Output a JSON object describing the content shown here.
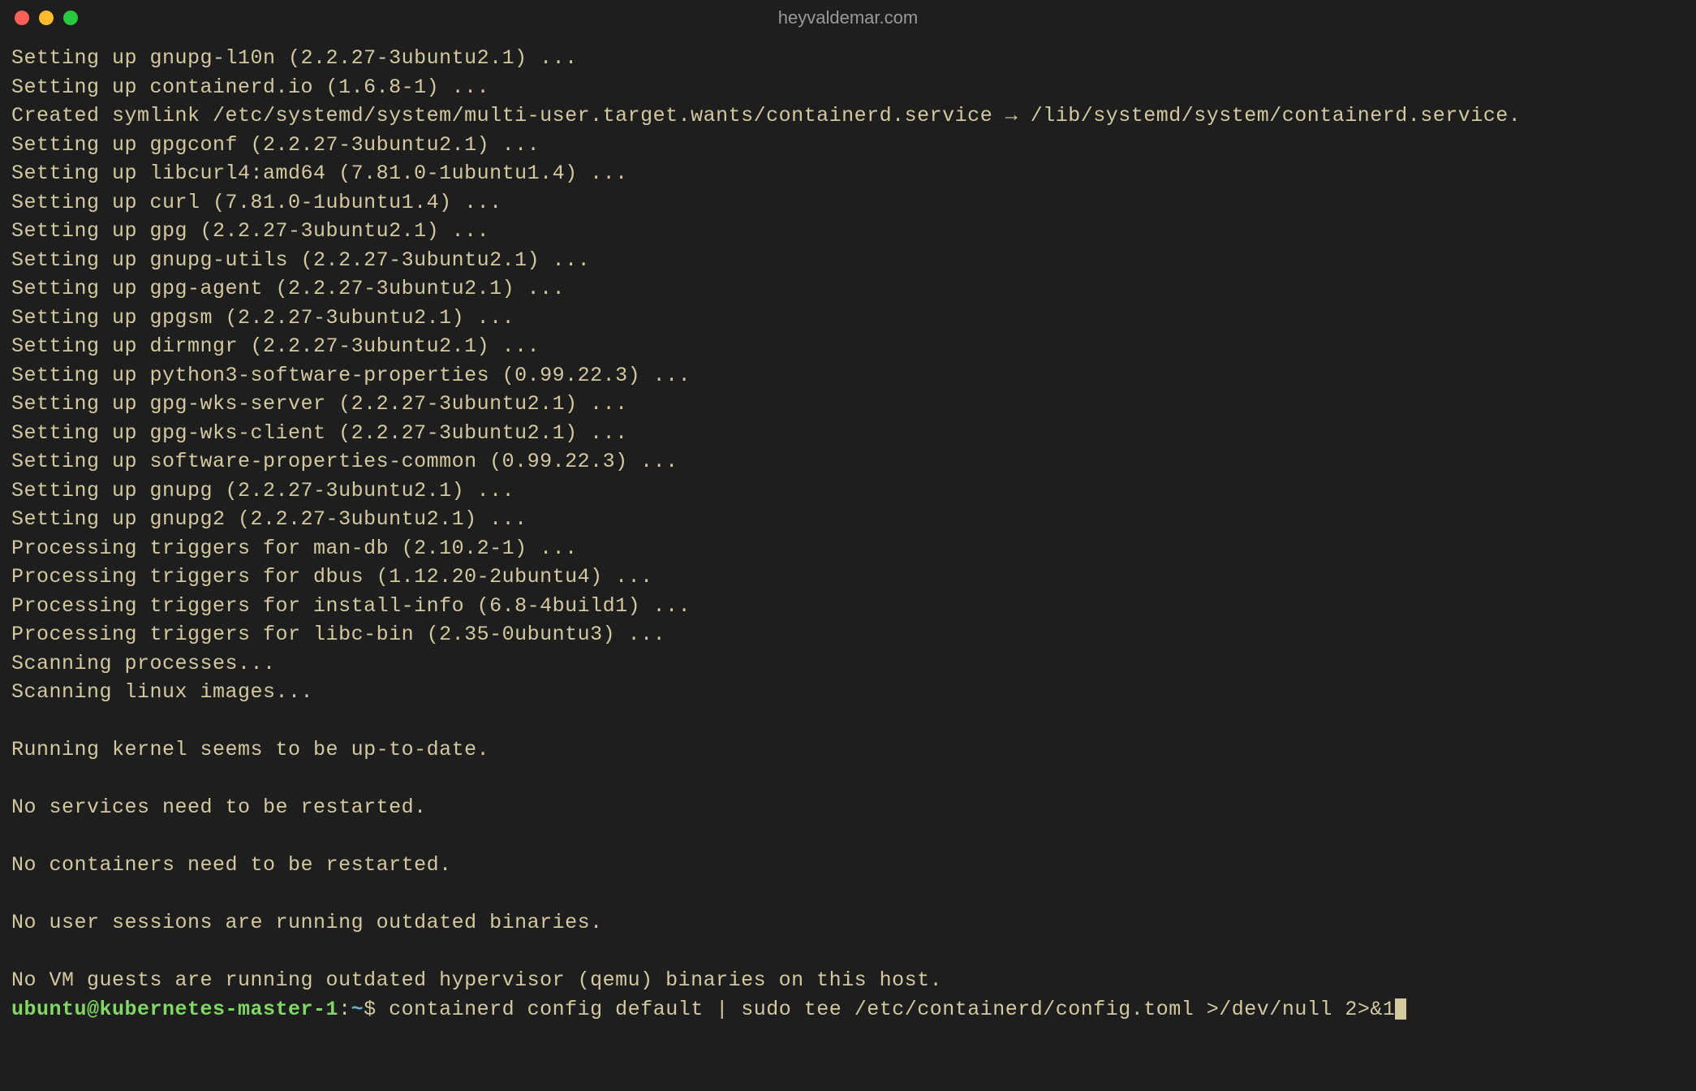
{
  "window": {
    "title": "heyvaldemar.com"
  },
  "output_lines": [
    "Setting up gnupg-l10n (2.2.27-3ubuntu2.1) ...",
    "Setting up containerd.io (1.6.8-1) ...",
    "Created symlink /etc/systemd/system/multi-user.target.wants/containerd.service → /lib/systemd/system/containerd.service.",
    "Setting up gpgconf (2.2.27-3ubuntu2.1) ...",
    "Setting up libcurl4:amd64 (7.81.0-1ubuntu1.4) ...",
    "Setting up curl (7.81.0-1ubuntu1.4) ...",
    "Setting up gpg (2.2.27-3ubuntu2.1) ...",
    "Setting up gnupg-utils (2.2.27-3ubuntu2.1) ...",
    "Setting up gpg-agent (2.2.27-3ubuntu2.1) ...",
    "Setting up gpgsm (2.2.27-3ubuntu2.1) ...",
    "Setting up dirmngr (2.2.27-3ubuntu2.1) ...",
    "Setting up python3-software-properties (0.99.22.3) ...",
    "Setting up gpg-wks-server (2.2.27-3ubuntu2.1) ...",
    "Setting up gpg-wks-client (2.2.27-3ubuntu2.1) ...",
    "Setting up software-properties-common (0.99.22.3) ...",
    "Setting up gnupg (2.2.27-3ubuntu2.1) ...",
    "Setting up gnupg2 (2.2.27-3ubuntu2.1) ...",
    "Processing triggers for man-db (2.10.2-1) ...",
    "Processing triggers for dbus (1.12.20-2ubuntu4) ...",
    "Processing triggers for install-info (6.8-4build1) ...",
    "Processing triggers for libc-bin (2.35-0ubuntu3) ...",
    "Scanning processes...",
    "Scanning linux images...",
    "",
    "Running kernel seems to be up-to-date.",
    "",
    "No services need to be restarted.",
    "",
    "No containers need to be restarted.",
    "",
    "No user sessions are running outdated binaries.",
    "",
    "No VM guests are running outdated hypervisor (qemu) binaries on this host."
  ],
  "prompt": {
    "user_host": "ubuntu@kubernetes-master-1",
    "separator": ":",
    "path": "~",
    "symbol": "$",
    "command": "containerd config default | sudo tee /etc/containerd/config.toml >/dev/null 2>&1"
  }
}
